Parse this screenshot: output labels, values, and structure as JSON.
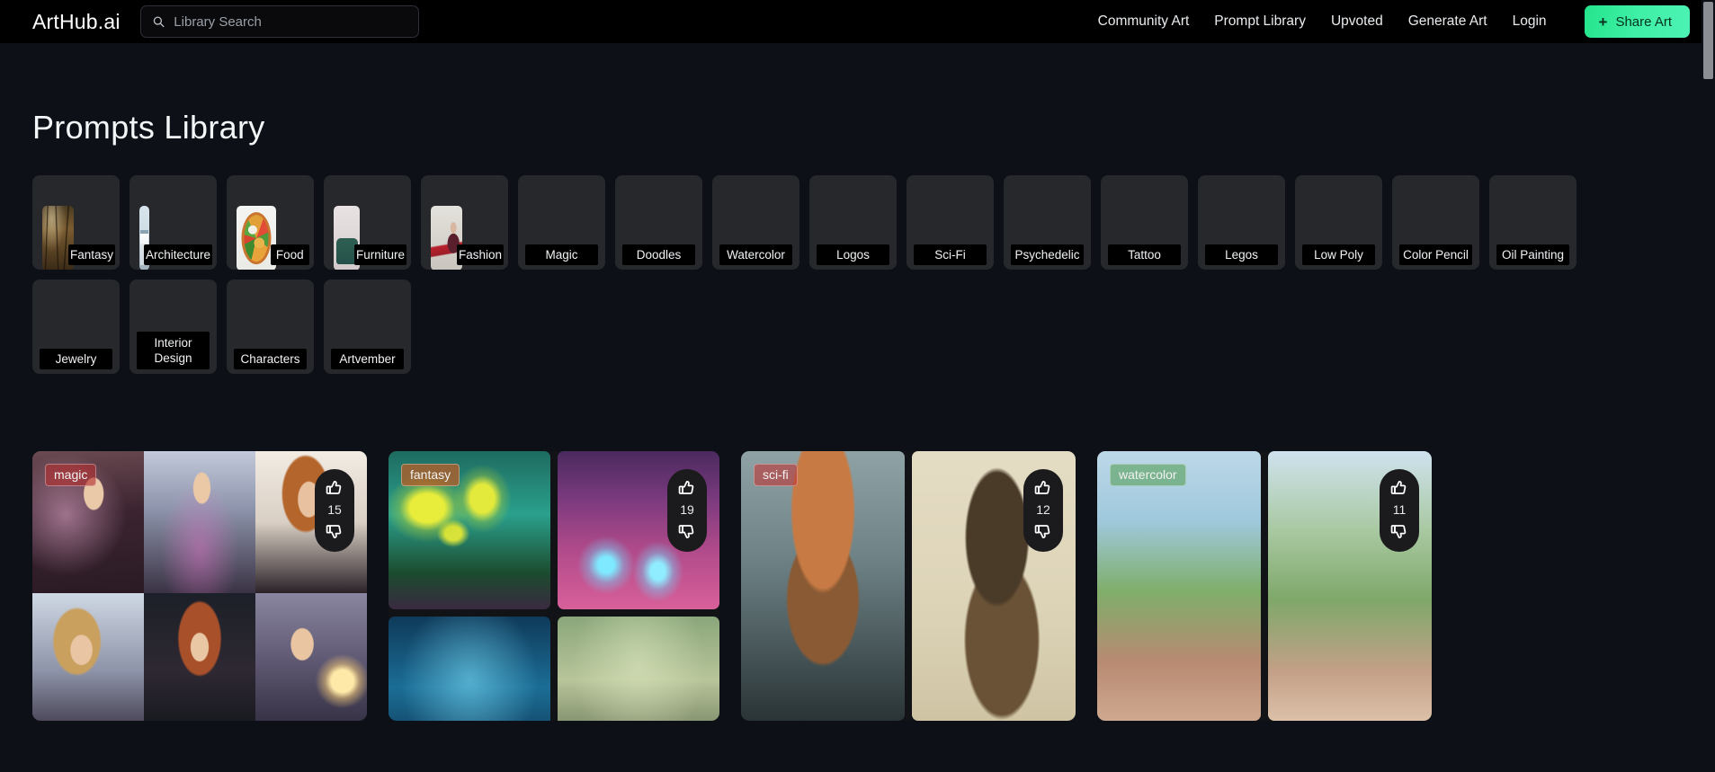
{
  "header": {
    "brand": "ArtHub.ai",
    "search": {
      "placeholder": "Library Search",
      "value": "",
      "icon": "search-icon"
    },
    "nav": [
      {
        "label": "Community Art"
      },
      {
        "label": "Prompt Library"
      },
      {
        "label": "Upvoted"
      },
      {
        "label": "Generate Art"
      },
      {
        "label": "Login"
      }
    ],
    "share_button": {
      "label": "Share Art",
      "plus": "+",
      "color": "#3ff0a6"
    }
  },
  "page": {
    "title": "Prompts Library",
    "background": "#0d1117"
  },
  "categories": [
    {
      "label": "Fantasy",
      "art": "art-fantasy",
      "has_image": true
    },
    {
      "label": "Architecture",
      "art": "art-arch",
      "has_image": true
    },
    {
      "label": "Food",
      "art": "art-food",
      "has_image": true
    },
    {
      "label": "Furniture",
      "art": "art-furniture",
      "has_image": true
    },
    {
      "label": "Fashion",
      "art": "art-fashion",
      "has_image": true
    },
    {
      "label": "Magic",
      "art": "",
      "has_image": false
    },
    {
      "label": "Doodles",
      "art": "",
      "has_image": false
    },
    {
      "label": "Watercolor",
      "art": "",
      "has_image": false
    },
    {
      "label": "Logos",
      "art": "",
      "has_image": false
    },
    {
      "label": "Sci-Fi",
      "art": "",
      "has_image": false
    },
    {
      "label": "Psychedelic",
      "art": "",
      "has_image": false
    },
    {
      "label": "Tattoo",
      "art": "",
      "has_image": false
    },
    {
      "label": "Legos",
      "art": "",
      "has_image": false
    },
    {
      "label": "Low Poly",
      "art": "",
      "has_image": false
    },
    {
      "label": "Color Pencil",
      "art": "",
      "has_image": false
    },
    {
      "label": "Oil Painting",
      "art": "",
      "has_image": false
    },
    {
      "label": "Jewelry",
      "art": "",
      "has_image": false
    },
    {
      "label": "Interior Design",
      "art": "",
      "has_image": false
    },
    {
      "label": "Characters",
      "art": "",
      "has_image": false
    },
    {
      "label": "Artvember",
      "art": "",
      "has_image": false
    }
  ],
  "art_cards": [
    {
      "badge": "magic",
      "upvotes": "15"
    },
    {
      "badge": "fantasy",
      "upvotes": "19"
    },
    {
      "badge": "sci-fi",
      "upvotes": "12"
    },
    {
      "badge": "watercolor",
      "upvotes": "11"
    }
  ],
  "vote": {
    "up_icon": "thumbs-up-icon",
    "down_icon": "thumbs-down-icon"
  }
}
